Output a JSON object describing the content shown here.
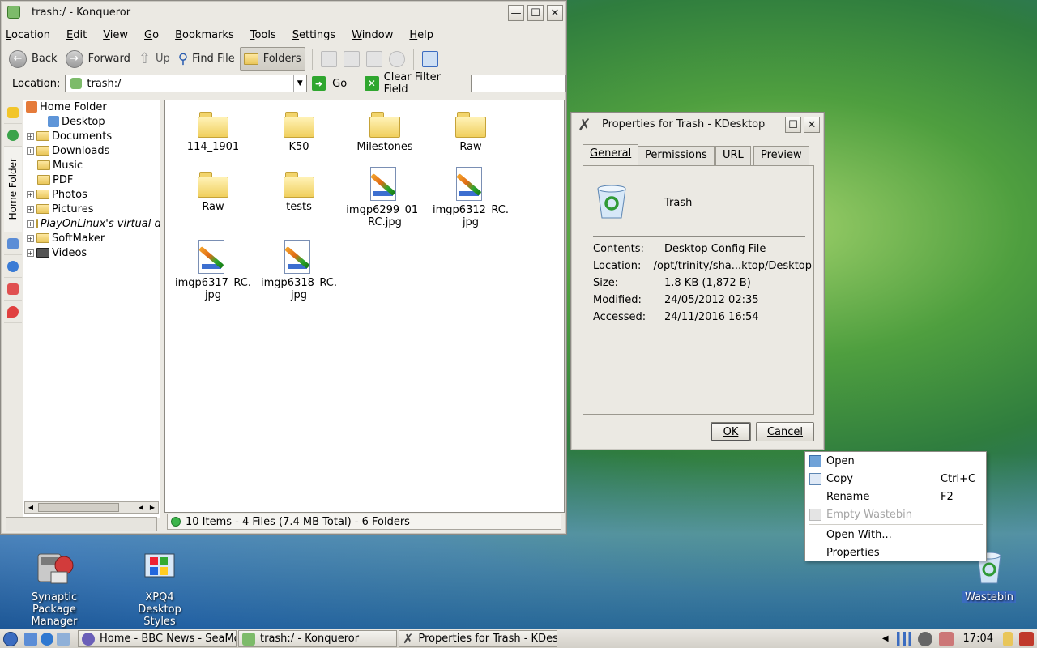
{
  "desktop": {
    "icons": [
      {
        "label": "Synaptic Package Manager"
      },
      {
        "label": "XPQ4 Desktop Styles"
      },
      {
        "label": "Wastebin"
      }
    ]
  },
  "konqueror": {
    "title": "trash:/ - Konqueror",
    "menu": [
      "Location",
      "Edit",
      "View",
      "Go",
      "Bookmarks",
      "Tools",
      "Settings",
      "Window",
      "Help"
    ],
    "toolbar": {
      "back": "Back",
      "forward": "Forward",
      "up": "Up",
      "find": "Find File",
      "folders": "Folders"
    },
    "location": {
      "label": "Location:",
      "value": "trash:/",
      "go": "Go",
      "clear_filter": "Clear Filter Field",
      "filter_value": ""
    },
    "sidebar_tab": "Home Folder",
    "tree": {
      "root": "Home Folder",
      "items": [
        "Desktop",
        "Documents",
        "Downloads",
        "Music",
        "PDF",
        "Photos",
        "Pictures",
        "PlayOnLinux's virtual d",
        "SoftMaker",
        "Videos"
      ]
    },
    "files": [
      {
        "name": "114_1901",
        "type": "folder"
      },
      {
        "name": "K50",
        "type": "folder"
      },
      {
        "name": "Milestones",
        "type": "folder"
      },
      {
        "name": "Raw",
        "type": "folder"
      },
      {
        "name": "Raw",
        "type": "folder"
      },
      {
        "name": "tests",
        "type": "folder"
      },
      {
        "name": "imgp6299_01_\nRC.jpg",
        "type": "image"
      },
      {
        "name": "imgp6312_RC.\njpg",
        "type": "image"
      },
      {
        "name": "imgp6317_RC.\njpg",
        "type": "image"
      },
      {
        "name": "imgp6318_RC.\njpg",
        "type": "image"
      }
    ],
    "status": "10 Items - 4 Files (7.4 MB Total) - 6 Folders"
  },
  "properties": {
    "title": "Properties for Trash - KDesktop",
    "tabs": [
      "General",
      "Permissions",
      "URL",
      "Preview"
    ],
    "name": "Trash",
    "rows": [
      {
        "label": "Contents:",
        "value": "Desktop Config File"
      },
      {
        "label": "Location:",
        "value": "/opt/trinity/sha...ktop/Desktop"
      },
      {
        "label": "Size:",
        "value": "1.8 KB (1,872 B)"
      },
      {
        "label": "Modified:",
        "value": "24/05/2012 02:35"
      },
      {
        "label": "Accessed:",
        "value": "24/11/2016 16:54"
      }
    ],
    "ok": "OK",
    "cancel": "Cancel"
  },
  "context_menu": {
    "items": [
      {
        "label": "Open",
        "shortcut": ""
      },
      {
        "label": "Copy",
        "shortcut": "Ctrl+C"
      },
      {
        "label": "Rename",
        "shortcut": "F2"
      },
      {
        "label": "Empty Wastebin",
        "shortcut": ""
      },
      {
        "label": "Open With...",
        "shortcut": ""
      },
      {
        "label": "Properties",
        "shortcut": ""
      }
    ]
  },
  "taskbar": {
    "tasks": [
      "Home - BBC News - SeaMonkey",
      "trash:/ - Konqueror",
      "Properties for Trash - KDesktop"
    ],
    "clock": "17:04"
  }
}
